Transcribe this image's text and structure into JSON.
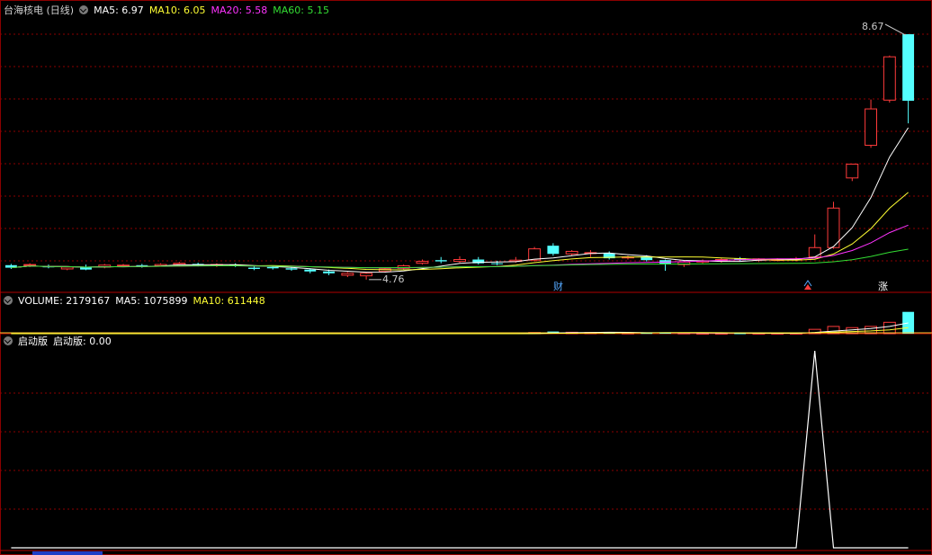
{
  "header": {
    "stock_title": "台海核电 (日线)",
    "ma5": "MA5: 6.97",
    "ma10": "MA10: 6.05",
    "ma20": "MA20: 5.58",
    "ma60": "MA60: 5.15"
  },
  "volume_header": {
    "label": "VOLUME: 2179167",
    "ma5": "MA5: 1075899",
    "ma10": "MA10: 611448"
  },
  "indicator_header": {
    "name": "启动版",
    "value_label": "启动版: 0.00"
  },
  "colors": {
    "up": "#ff3b3b",
    "down": "#54ffff",
    "ma5": "#ffffff",
    "ma10": "#ffff33",
    "ma20": "#ff33ff",
    "ma60": "#33dd33",
    "grid": "#8b0000"
  },
  "chart_data": [
    {
      "type": "candlestick",
      "annotations": {
        "high_label": "8.67",
        "low_label": "4.76",
        "event_marks": [
          "财",
          "涨"
        ]
      },
      "candles": [
        {
          "o": 4.99,
          "h": 5.01,
          "c": 4.95,
          "l": 4.93
        },
        {
          "o": 5.0,
          "h": 5.02,
          "c": 5.0,
          "l": 4.96
        },
        {
          "o": 4.97,
          "h": 5.0,
          "c": 4.96,
          "l": 4.94
        },
        {
          "o": 4.93,
          "h": 4.97,
          "c": 4.96,
          "l": 4.91
        },
        {
          "o": 4.96,
          "h": 5.0,
          "c": 4.92,
          "l": 4.91
        },
        {
          "o": 4.96,
          "h": 5.01,
          "c": 4.99,
          "l": 4.94
        },
        {
          "o": 4.99,
          "h": 5.01,
          "c": 4.99,
          "l": 4.96
        },
        {
          "o": 4.99,
          "h": 5.01,
          "c": 4.98,
          "l": 4.95
        },
        {
          "o": 4.98,
          "h": 5.02,
          "c": 5.0,
          "l": 4.97
        },
        {
          "o": 5.0,
          "h": 5.04,
          "c": 5.02,
          "l": 4.97
        },
        {
          "o": 5.01,
          "h": 5.03,
          "c": 4.99,
          "l": 4.97
        },
        {
          "o": 4.99,
          "h": 5.02,
          "c": 5.0,
          "l": 4.96
        },
        {
          "o": 5.0,
          "h": 5.02,
          "c": 4.98,
          "l": 4.96
        },
        {
          "o": 4.95,
          "h": 4.98,
          "c": 4.93,
          "l": 4.91
        },
        {
          "o": 4.96,
          "h": 4.98,
          "c": 4.94,
          "l": 4.92
        },
        {
          "o": 4.94,
          "h": 4.96,
          "c": 4.92,
          "l": 4.9
        },
        {
          "o": 4.92,
          "h": 4.94,
          "c": 4.89,
          "l": 4.86
        },
        {
          "o": 4.89,
          "h": 4.92,
          "c": 4.86,
          "l": 4.83
        },
        {
          "o": 4.83,
          "h": 4.88,
          "c": 4.86,
          "l": 4.8
        },
        {
          "o": 4.82,
          "h": 4.88,
          "c": 4.86,
          "l": 4.76
        },
        {
          "o": 4.89,
          "h": 4.95,
          "c": 4.93,
          "l": 4.87
        },
        {
          "o": 4.94,
          "h": 5.0,
          "c": 4.98,
          "l": 4.92
        },
        {
          "o": 5.02,
          "h": 5.08,
          "c": 5.05,
          "l": 5.0
        },
        {
          "o": 5.07,
          "h": 5.12,
          "c": 5.05,
          "l": 5.02
        },
        {
          "o": 5.05,
          "h": 5.13,
          "c": 5.08,
          "l": 5.03
        },
        {
          "o": 5.08,
          "h": 5.12,
          "c": 5.02,
          "l": 5.0
        },
        {
          "o": 5.02,
          "h": 5.06,
          "c": 5.01,
          "l": 4.99
        },
        {
          "o": 5.05,
          "h": 5.12,
          "c": 5.07,
          "l": 5.03
        },
        {
          "o": 5.07,
          "h": 5.28,
          "c": 5.25,
          "l": 5.05
        },
        {
          "o": 5.3,
          "h": 5.34,
          "c": 5.17,
          "l": 5.14
        },
        {
          "o": 5.17,
          "h": 5.23,
          "c": 5.21,
          "l": 5.14
        },
        {
          "o": 5.18,
          "h": 5.23,
          "c": 5.19,
          "l": 5.12
        },
        {
          "o": 5.18,
          "h": 5.21,
          "c": 5.1,
          "l": 5.08
        },
        {
          "o": 5.11,
          "h": 5.14,
          "c": 5.12,
          "l": 5.08
        },
        {
          "o": 5.13,
          "h": 5.15,
          "c": 5.07,
          "l": 5.05
        },
        {
          "o": 5.07,
          "h": 5.08,
          "c": 5.0,
          "l": 4.9
        },
        {
          "o": 5.0,
          "h": 5.07,
          "c": 5.04,
          "l": 4.96
        },
        {
          "o": 5.04,
          "h": 5.08,
          "c": 5.06,
          "l": 5.02
        },
        {
          "o": 5.06,
          "h": 5.1,
          "c": 5.08,
          "l": 5.03
        },
        {
          "o": 5.1,
          "h": 5.12,
          "c": 5.07,
          "l": 5.05
        },
        {
          "o": 5.07,
          "h": 5.1,
          "c": 5.09,
          "l": 5.04
        },
        {
          "o": 5.08,
          "h": 5.1,
          "c": 5.08,
          "l": 5.05
        },
        {
          "o": 5.08,
          "h": 5.12,
          "c": 5.09,
          "l": 5.05
        },
        {
          "o": 5.12,
          "h": 5.48,
          "c": 5.27,
          "l": 5.1
        },
        {
          "o": 5.27,
          "h": 6.0,
          "c": 5.9,
          "l": 5.25
        },
        {
          "o": 6.38,
          "h": 6.51,
          "c": 6.6,
          "l": 6.33
        },
        {
          "o": 6.9,
          "h": 7.63,
          "c": 7.48,
          "l": 6.86
        },
        {
          "o": 7.62,
          "h": 8.33,
          "c": 8.31,
          "l": 7.58
        },
        {
          "o": 8.67,
          "h": 8.67,
          "c": 7.61,
          "l": 7.25
        }
      ],
      "event_mark_indices": [
        29,
        43,
        47
      ],
      "ylim": [
        4.6,
        8.9
      ]
    },
    {
      "type": "bar",
      "name": "VOLUME",
      "values": [
        0,
        0,
        0,
        0,
        0,
        0,
        0,
        0,
        0,
        0,
        0,
        0,
        0,
        0,
        0,
        0,
        0,
        0,
        0,
        0,
        0,
        0,
        0,
        0,
        0,
        0,
        0,
        0,
        0.05,
        0.09,
        0.06,
        0.05,
        0.04,
        0.03,
        0.03,
        0.05,
        0.03,
        0.02,
        0.02,
        0.02,
        0.02,
        0.02,
        0.02,
        0.18,
        0.3,
        0.25,
        0.3,
        0.47,
        0.9
      ],
      "ylim": [
        0,
        1
      ]
    },
    {
      "type": "line",
      "name": "启动版",
      "values": [
        0,
        0,
        0,
        0,
        0,
        0,
        0,
        0,
        0,
        0,
        0,
        0,
        0,
        0,
        0,
        0,
        0,
        0,
        0,
        0,
        0,
        0,
        0,
        0,
        0,
        0,
        0,
        0,
        0,
        0,
        0,
        0,
        0,
        0,
        0,
        0,
        0,
        0,
        0,
        0,
        0,
        0,
        0,
        1,
        0,
        0,
        0,
        0,
        0
      ],
      "ylim": [
        0,
        1
      ]
    }
  ]
}
